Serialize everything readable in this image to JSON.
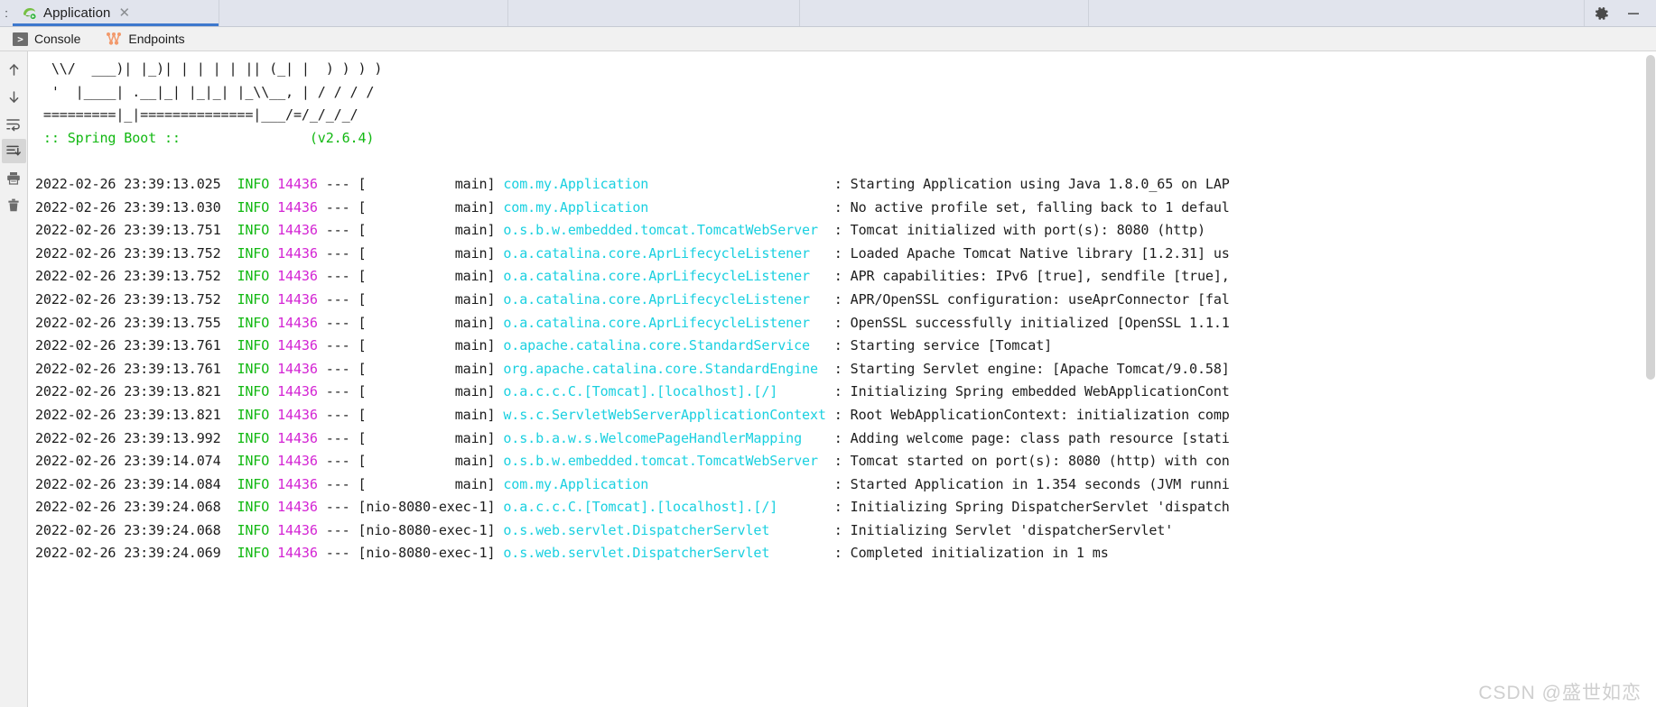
{
  "window": {
    "leading_glyph": ":",
    "tab": {
      "label": "Application",
      "icon": "spring-run-icon",
      "close_icon": "close-icon"
    },
    "actions": [
      {
        "name": "settings-gear",
        "icon": "gear-icon"
      },
      {
        "name": "minimize",
        "icon": "minimize-icon"
      }
    ]
  },
  "subbar": {
    "tabs": [
      {
        "label": "Console",
        "icon": "console-icon"
      },
      {
        "label": "Endpoints",
        "icon": "endpoints-icon"
      }
    ]
  },
  "gutter": {
    "buttons": [
      {
        "name": "scroll-up-button",
        "icon": "arrow-up-icon",
        "selected": false
      },
      {
        "name": "scroll-down-button",
        "icon": "arrow-down-icon",
        "selected": false
      },
      {
        "name": "soft-wrap-button",
        "icon": "soft-wrap-icon",
        "selected": false
      },
      {
        "name": "scroll-to-end-button",
        "icon": "scroll-to-end-icon",
        "selected": true
      },
      {
        "name": "print-button",
        "icon": "printer-icon",
        "selected": false
      },
      {
        "name": "clear-all-button",
        "icon": "trash-icon",
        "selected": false
      }
    ]
  },
  "console": {
    "banner": [
      "  \\\\/  ___)| |_)| | | | | || (_| |  ) ) ) )",
      "  '  |____| .__|_| |_|_| |_\\\\__, | / / / /",
      " =========|_|==============|___/=/_/_/_/"
    ],
    "banner_version_line": {
      "title": " :: Spring Boot ::",
      "version": "(v2.6.4)",
      "gap_spaces": 16
    },
    "log_columns": [
      "timestamp",
      "level",
      "pid",
      "sep",
      "thread",
      "logger",
      "message"
    ],
    "logs": [
      {
        "timestamp": "2022-02-26 23:39:13.025",
        "level": "INFO",
        "pid": "14436",
        "sep": "---",
        "thread": "main",
        "logger": "com.my.Application",
        "message": "Starting Application using Java 1.8.0_65 on LAP"
      },
      {
        "timestamp": "2022-02-26 23:39:13.030",
        "level": "INFO",
        "pid": "14436",
        "sep": "---",
        "thread": "main",
        "logger": "com.my.Application",
        "message": "No active profile set, falling back to 1 defaul"
      },
      {
        "timestamp": "2022-02-26 23:39:13.751",
        "level": "INFO",
        "pid": "14436",
        "sep": "---",
        "thread": "main",
        "logger": "o.s.b.w.embedded.tomcat.TomcatWebServer",
        "message": "Tomcat initialized with port(s): 8080 (http)"
      },
      {
        "timestamp": "2022-02-26 23:39:13.752",
        "level": "INFO",
        "pid": "14436",
        "sep": "---",
        "thread": "main",
        "logger": "o.a.catalina.core.AprLifecycleListener",
        "message": "Loaded Apache Tomcat Native library [1.2.31] us"
      },
      {
        "timestamp": "2022-02-26 23:39:13.752",
        "level": "INFO",
        "pid": "14436",
        "sep": "---",
        "thread": "main",
        "logger": "o.a.catalina.core.AprLifecycleListener",
        "message": "APR capabilities: IPv6 [true], sendfile [true],"
      },
      {
        "timestamp": "2022-02-26 23:39:13.752",
        "level": "INFO",
        "pid": "14436",
        "sep": "---",
        "thread": "main",
        "logger": "o.a.catalina.core.AprLifecycleListener",
        "message": "APR/OpenSSL configuration: useAprConnector [fal"
      },
      {
        "timestamp": "2022-02-26 23:39:13.755",
        "level": "INFO",
        "pid": "14436",
        "sep": "---",
        "thread": "main",
        "logger": "o.a.catalina.core.AprLifecycleListener",
        "message": "OpenSSL successfully initialized [OpenSSL 1.1.1"
      },
      {
        "timestamp": "2022-02-26 23:39:13.761",
        "level": "INFO",
        "pid": "14436",
        "sep": "---",
        "thread": "main",
        "logger": "o.apache.catalina.core.StandardService",
        "message": "Starting service [Tomcat]"
      },
      {
        "timestamp": "2022-02-26 23:39:13.761",
        "level": "INFO",
        "pid": "14436",
        "sep": "---",
        "thread": "main",
        "logger": "org.apache.catalina.core.StandardEngine",
        "message": "Starting Servlet engine: [Apache Tomcat/9.0.58]"
      },
      {
        "timestamp": "2022-02-26 23:39:13.821",
        "level": "INFO",
        "pid": "14436",
        "sep": "---",
        "thread": "main",
        "logger": "o.a.c.c.C.[Tomcat].[localhost].[/]",
        "message": "Initializing Spring embedded WebApplicationCont"
      },
      {
        "timestamp": "2022-02-26 23:39:13.821",
        "level": "INFO",
        "pid": "14436",
        "sep": "---",
        "thread": "main",
        "logger": "w.s.c.ServletWebServerApplicationContext",
        "message": "Root WebApplicationContext: initialization comp"
      },
      {
        "timestamp": "2022-02-26 23:39:13.992",
        "level": "INFO",
        "pid": "14436",
        "sep": "---",
        "thread": "main",
        "logger": "o.s.b.a.w.s.WelcomePageHandlerMapping",
        "message": "Adding welcome page: class path resource [stati"
      },
      {
        "timestamp": "2022-02-26 23:39:14.074",
        "level": "INFO",
        "pid": "14436",
        "sep": "---",
        "thread": "main",
        "logger": "o.s.b.w.embedded.tomcat.TomcatWebServer",
        "message": "Tomcat started on port(s): 8080 (http) with con"
      },
      {
        "timestamp": "2022-02-26 23:39:14.084",
        "level": "INFO",
        "pid": "14436",
        "sep": "---",
        "thread": "main",
        "logger": "com.my.Application",
        "message": "Started Application in 1.354 seconds (JVM runni"
      },
      {
        "timestamp": "2022-02-26 23:39:24.068",
        "level": "INFO",
        "pid": "14436",
        "sep": "---",
        "thread": "nio-8080-exec-1",
        "logger": "o.a.c.c.C.[Tomcat].[localhost].[/]",
        "message": "Initializing Spring DispatcherServlet 'dispatch"
      },
      {
        "timestamp": "2022-02-26 23:39:24.068",
        "level": "INFO",
        "pid": "14436",
        "sep": "---",
        "thread": "nio-8080-exec-1",
        "logger": "o.s.web.servlet.DispatcherServlet",
        "message": "Initializing Servlet 'dispatcherServlet'"
      },
      {
        "timestamp": "2022-02-26 23:39:24.069",
        "level": "INFO",
        "pid": "14436",
        "sep": "---",
        "thread": "nio-8080-exec-1",
        "logger": "o.s.web.servlet.DispatcherServlet",
        "message": "Completed initialization in 1 ms"
      }
    ]
  },
  "watermark": "CSDN @盛世如恋",
  "colors": {
    "titlebar_bg": "#e1e4ed",
    "subbar_bg": "#f1f1f1",
    "accent": "#3d78cd",
    "level_info": "#12b812",
    "pid": "#d426d4",
    "logger": "#1ad0e0",
    "text": "#1d1d1d",
    "console_bg": "#ffffff"
  }
}
